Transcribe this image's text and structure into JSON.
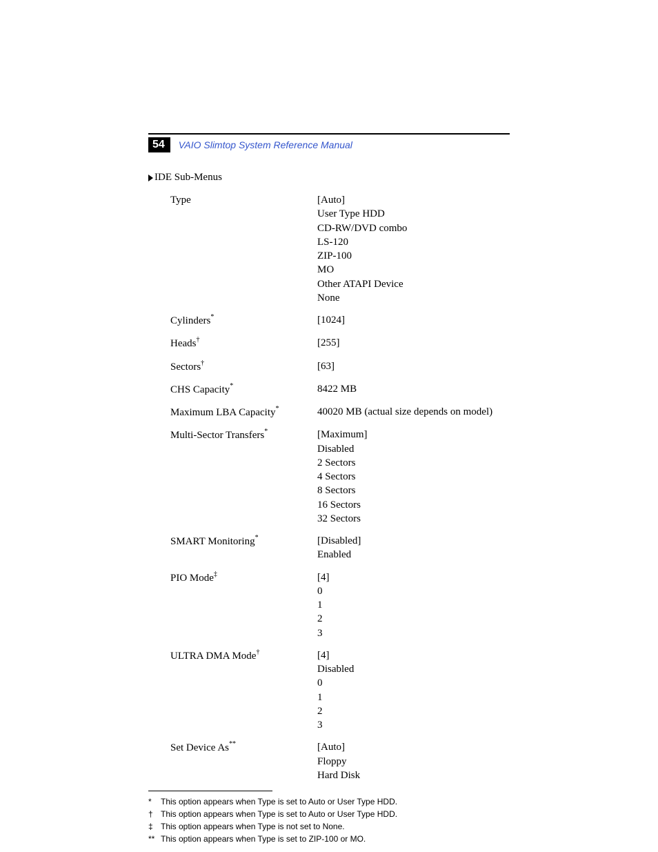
{
  "header": {
    "page_number": "54",
    "title": "VAIO Slimtop System Reference Manual"
  },
  "section_title": "IDE Sub-Menus",
  "rows": [
    {
      "label": "Type",
      "sup": "",
      "values": [
        "[Auto]",
        "User Type HDD",
        "CD-RW/DVD combo",
        "LS-120",
        "ZIP-100",
        "MO",
        "Other ATAPI Device",
        "None"
      ]
    },
    {
      "label": "Cylinders",
      "sup": "*",
      "values": [
        "[1024]"
      ]
    },
    {
      "label": "Heads",
      "sup": "†",
      "values": [
        "[255]"
      ]
    },
    {
      "label": "Sectors",
      "sup": "†",
      "values": [
        "[63]"
      ]
    },
    {
      "label": "CHS Capacity",
      "sup": "*",
      "values": [
        "8422 MB"
      ]
    },
    {
      "label": "Maximum LBA Capacity",
      "sup": "*",
      "values": [
        "40020 MB (actual size depends on model)"
      ]
    },
    {
      "label": "Multi-Sector Transfers",
      "sup": "*",
      "values": [
        "[Maximum]",
        "Disabled",
        "2 Sectors",
        "4 Sectors",
        "8 Sectors",
        "16 Sectors",
        "32 Sectors"
      ]
    },
    {
      "label": "SMART Monitoring",
      "sup": "*",
      "values": [
        "[Disabled]",
        "Enabled"
      ]
    },
    {
      "label": "PIO Mode",
      "sup": "‡",
      "values": [
        "[4]",
        "0",
        "1",
        "2",
        "3"
      ]
    },
    {
      "label": "ULTRA DMA Mode",
      "sup": "†",
      "values": [
        "[4]",
        "Disabled",
        "0",
        "1",
        "2",
        "3"
      ]
    },
    {
      "label": "Set Device As",
      "sup": "**",
      "values": [
        "[Auto]",
        "Floppy",
        "Hard Disk"
      ]
    }
  ],
  "footnotes": [
    {
      "symbol": "*",
      "text": "This option appears when Type is set to Auto or User Type HDD."
    },
    {
      "symbol": "†",
      "text": "This option appears when Type is set to Auto or User Type HDD."
    },
    {
      "symbol": "‡",
      "text": "This option appears when Type is not set to None."
    },
    {
      "symbol": "**",
      "text": "This option appears when Type is set to ZIP-100 or MO."
    }
  ]
}
